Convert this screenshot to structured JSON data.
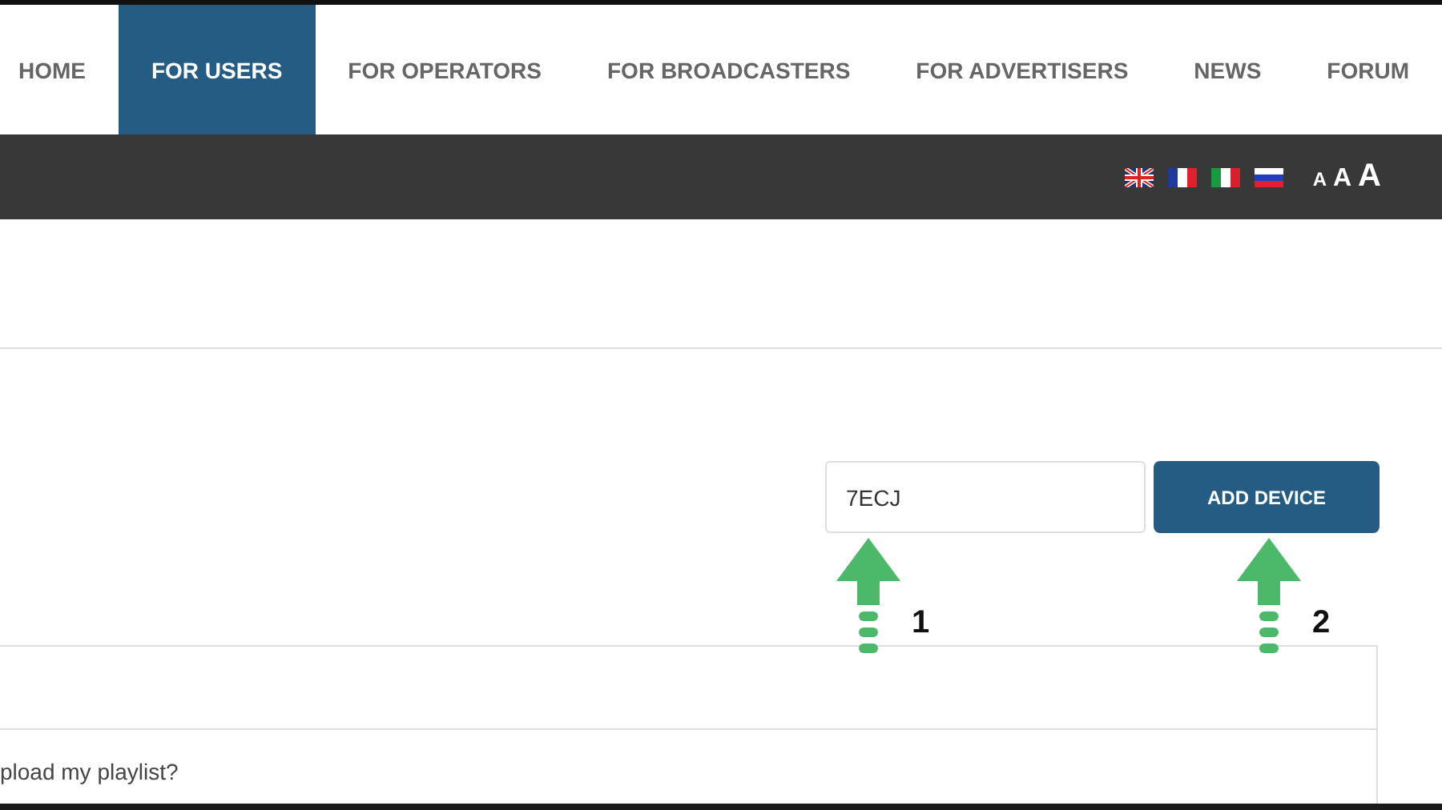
{
  "nav": {
    "items": [
      {
        "label": "HOME",
        "selected": false
      },
      {
        "label": "FOR USERS",
        "selected": true
      },
      {
        "label": "FOR OPERATORS",
        "selected": false
      },
      {
        "label": "FOR BROADCASTERS",
        "selected": false
      },
      {
        "label": "FOR ADVERTISERS",
        "selected": false
      },
      {
        "label": "NEWS",
        "selected": false
      },
      {
        "label": "FORUM",
        "selected": false
      }
    ]
  },
  "toolbar": {
    "languages": [
      {
        "kind": "uk"
      },
      {
        "kind": "fr"
      },
      {
        "kind": "it"
      },
      {
        "kind": "ru"
      }
    ],
    "font_sizes": [
      "A",
      "A",
      "A"
    ]
  },
  "device_form": {
    "code_field": {
      "value": "7ECJ"
    },
    "button": "ADD DEVICE",
    "annotations": [
      "1",
      "2"
    ]
  },
  "faq": {
    "rows": [
      "pload my playlist?"
    ]
  }
}
